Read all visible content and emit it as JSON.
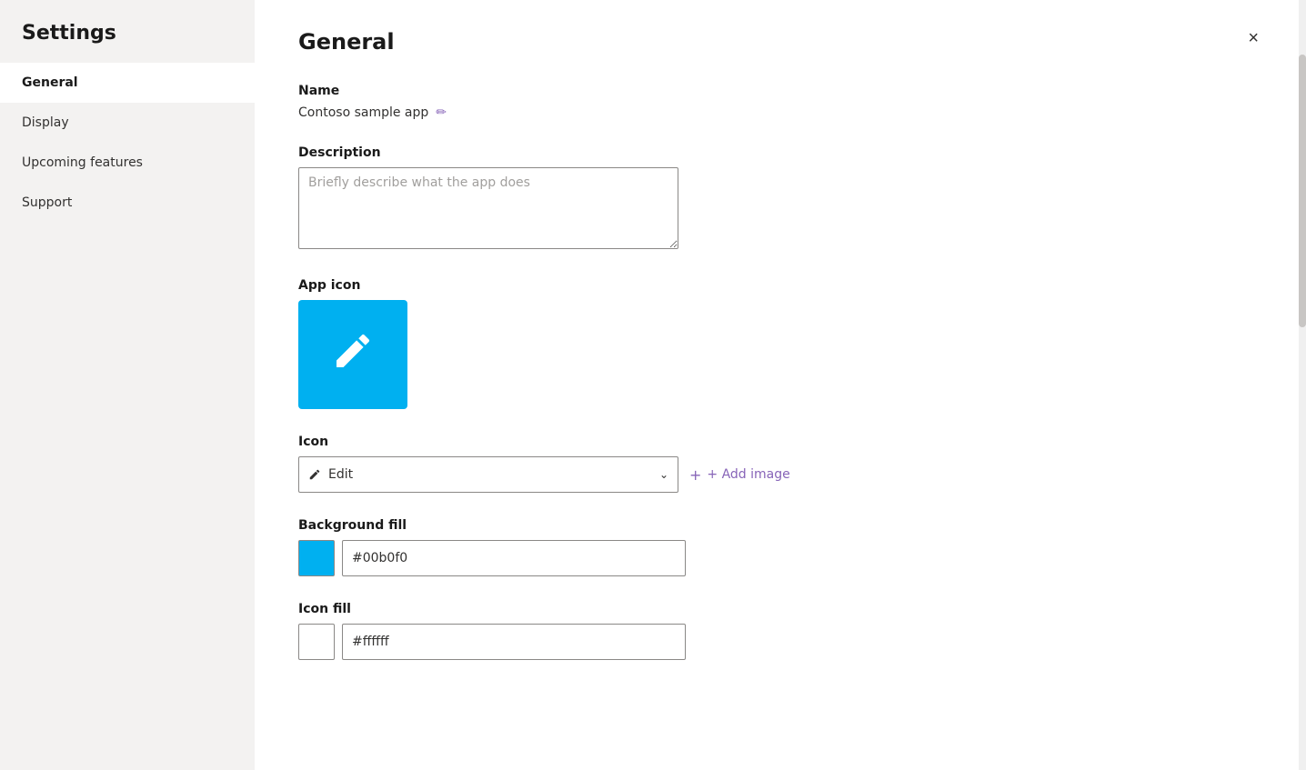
{
  "sidebar": {
    "title": "Settings",
    "nav_items": [
      {
        "id": "general",
        "label": "General",
        "active": true
      },
      {
        "id": "display",
        "label": "Display",
        "active": false
      },
      {
        "id": "upcoming-features",
        "label": "Upcoming features",
        "active": false
      },
      {
        "id": "support",
        "label": "Support",
        "active": false
      }
    ]
  },
  "panel": {
    "title": "General",
    "close_label": "×",
    "sections": {
      "name": {
        "label": "Name",
        "value": "Contoso sample app",
        "edit_icon": "✏"
      },
      "description": {
        "label": "Description",
        "placeholder": "Briefly describe what the app does"
      },
      "app_icon": {
        "label": "App icon",
        "icon_color": "#00b0f0"
      },
      "icon": {
        "label": "Icon",
        "dropdown_value": "Edit",
        "add_image_label": "+ Add image"
      },
      "background_fill": {
        "label": "Background fill",
        "color": "#00b0f0",
        "hex_value": "#00b0f0"
      },
      "icon_fill": {
        "label": "Icon fill",
        "color": "#ffffff",
        "hex_value": "#ffffff"
      }
    }
  }
}
